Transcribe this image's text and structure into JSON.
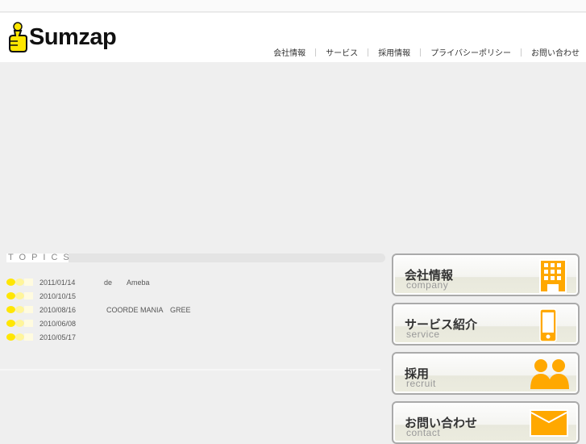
{
  "brand": {
    "name": "Sumzap"
  },
  "nav": [
    "会社情報",
    "サービス",
    "採用情報",
    "プライバシーポリシー",
    "お問い合わせ"
  ],
  "topics": {
    "label": "TOPICS",
    "items": [
      {
        "date": "2011/01/14",
        "title": "de　　Ameba"
      },
      {
        "date": "2010/10/15",
        "title": ""
      },
      {
        "date": "2010/08/16",
        "title": "COORDE MANIA　GREE"
      },
      {
        "date": "2010/06/08",
        "title": ""
      },
      {
        "date": "2010/05/17",
        "title": ""
      }
    ]
  },
  "buttons": [
    {
      "jp": "会社情報",
      "en": "company",
      "icon": "building-icon"
    },
    {
      "jp": "サービス紹介",
      "en": "service",
      "icon": "mobile-phone-icon"
    },
    {
      "jp": "採用",
      "en": "recruit",
      "icon": "people-icon"
    },
    {
      "jp": "お問い合わせ",
      "en": "contact",
      "icon": "envelope-icon"
    }
  ],
  "colors": {
    "accent": "#ffa800",
    "dot": "#ffe600"
  }
}
